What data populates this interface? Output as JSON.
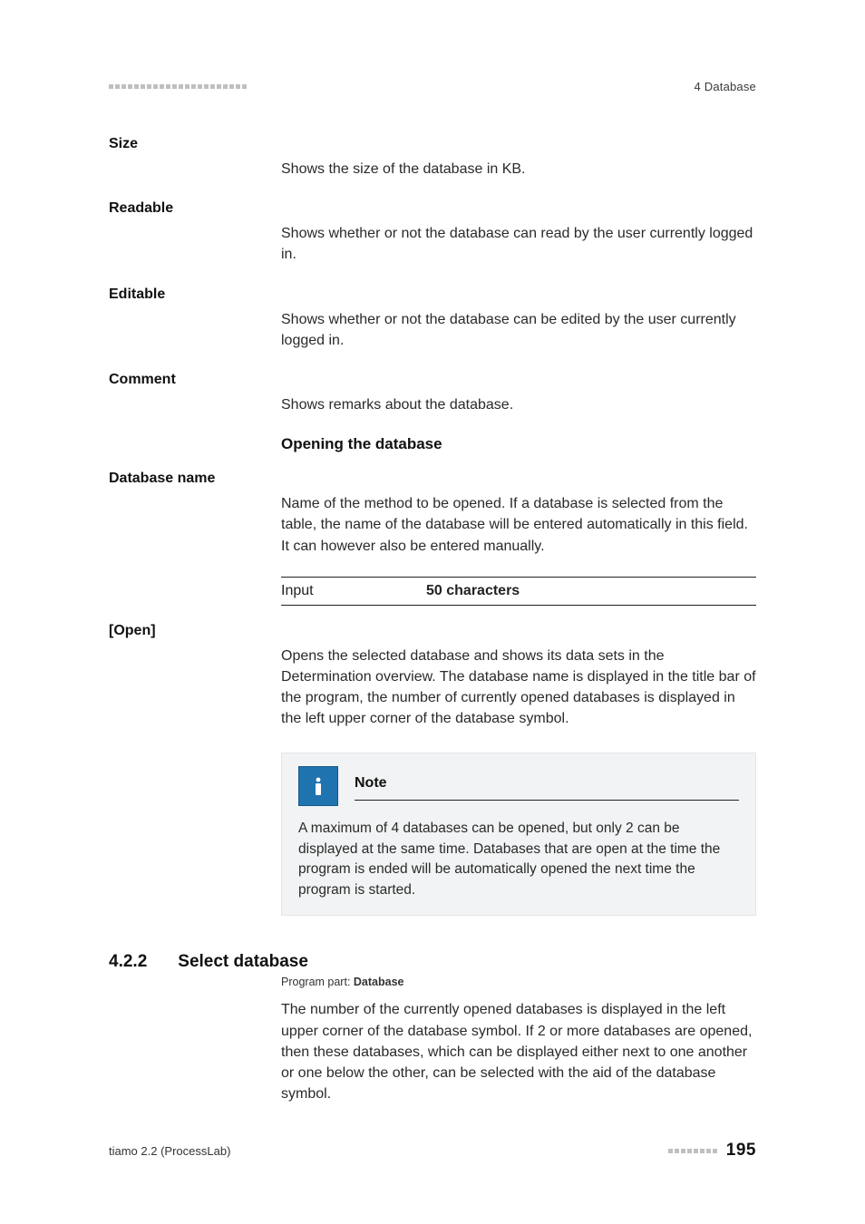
{
  "header": {
    "right": "4 Database"
  },
  "defs": {
    "size": {
      "term": "Size",
      "text": "Shows the size of the database in KB."
    },
    "readable": {
      "term": "Readable",
      "text": "Shows whether or not the database can read by the user currently logged in."
    },
    "editable": {
      "term": "Editable",
      "text": "Shows whether or not the database can be edited by the user currently logged in."
    },
    "comment": {
      "term": "Comment",
      "text": "Shows remarks about the database."
    }
  },
  "opening": {
    "heading": "Opening the database",
    "dbname": {
      "term": "Database name",
      "text": "Name of the method to be opened. If a database is selected from the table, the name of the database will be entered automatically in this field. It can however also be entered manually.",
      "input_label": "Input",
      "input_value": "50 characters"
    },
    "open": {
      "term": "[Open]",
      "text": "Opens the selected database and shows its data sets in the Determination overview. The database name is displayed in the title bar of the program, the number of currently opened databases is displayed in the left upper corner of the database symbol."
    },
    "note": {
      "title": "Note",
      "body": "A maximum of 4 databases can be opened, but only 2 can be displayed at the same time. Databases that are open at the time the program is ended will be automatically opened the next time the program is started."
    }
  },
  "section422": {
    "number": "4.2.2",
    "title": "Select database",
    "program_part_label": "Program part:",
    "program_part_value": "Database",
    "para": "The number of the currently opened databases is displayed in the left upper corner of the database symbol. If 2 or more databases are opened, then these databases, which can be displayed either next to one another or one below the other, can be selected with the aid of the database symbol."
  },
  "footer": {
    "left": "tiamo 2.2 (ProcessLab)",
    "page": "195"
  }
}
